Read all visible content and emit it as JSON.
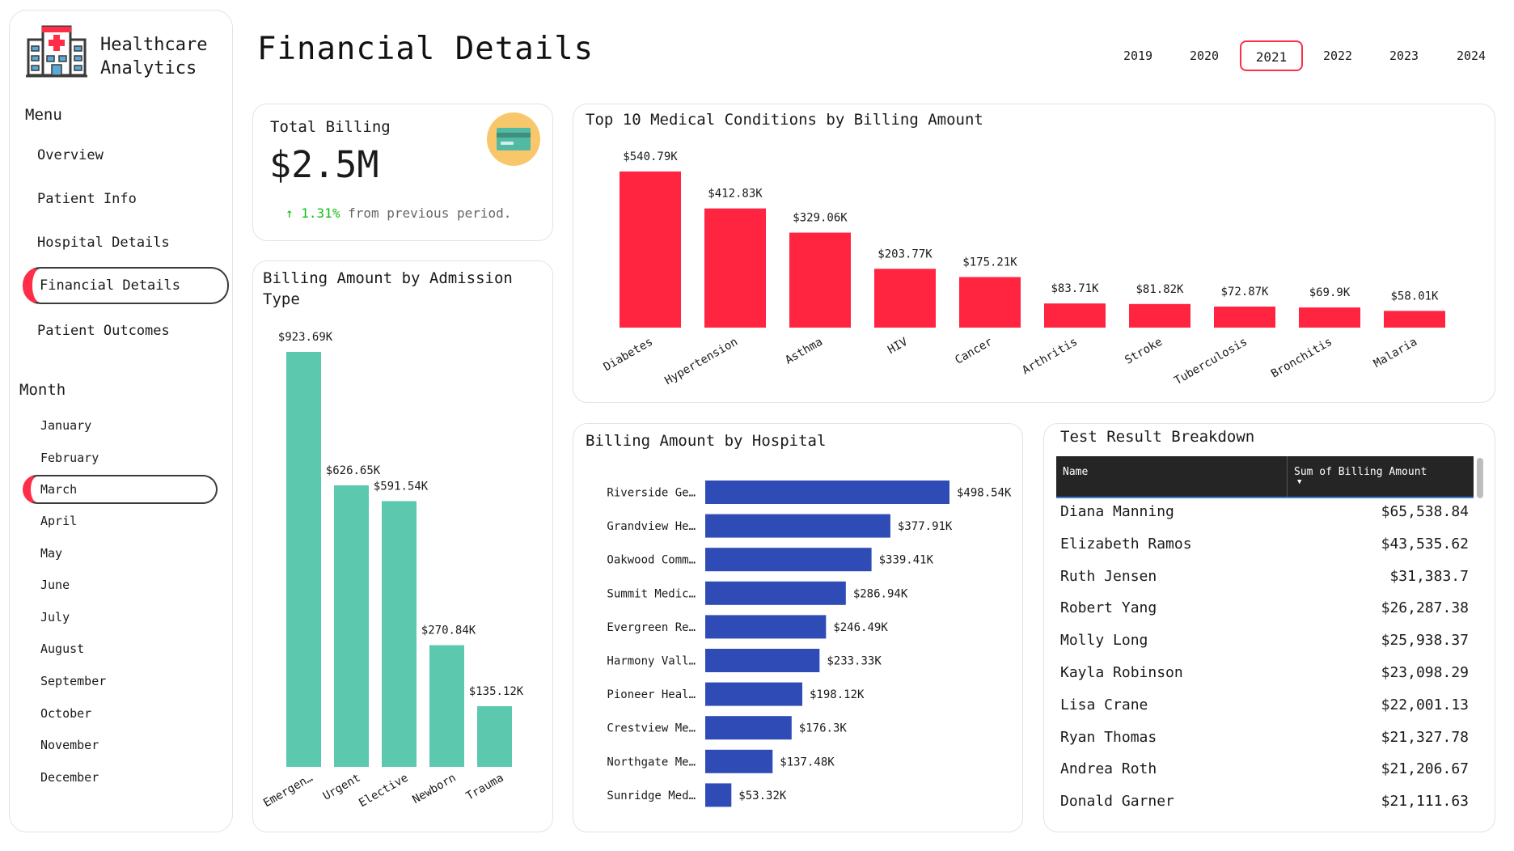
{
  "brand": {
    "line1": "Healthcare",
    "line2": "Analytics",
    "logo_icon": "hospital-building-icon"
  },
  "menu": {
    "heading": "Menu",
    "items": [
      {
        "label": "Overview",
        "active": false
      },
      {
        "label": "Patient Info",
        "active": false
      },
      {
        "label": "Hospital Details",
        "active": false
      },
      {
        "label": "Financial Details",
        "active": true
      },
      {
        "label": "Patient Outcomes",
        "active": false
      }
    ]
  },
  "month_filter": {
    "heading": "Month",
    "months": [
      "January",
      "February",
      "March",
      "April",
      "May",
      "June",
      "July",
      "August",
      "September",
      "October",
      "November",
      "December"
    ],
    "selected": "March"
  },
  "page_title": "Financial Details",
  "years": {
    "options": [
      "2019",
      "2020",
      "2021",
      "2022",
      "2023",
      "2024"
    ],
    "selected": "2021"
  },
  "total_billing": {
    "label": "Total Billing",
    "value": "$2.5M",
    "change_arrow": "↑",
    "change_pct": "1.31%",
    "change_text": "from previous period.",
    "icon": "credit-card-icon"
  },
  "colors": {
    "accent": "#ff2d47",
    "conditions_bar": "#ff2541",
    "admission_bar": "#5cc9af",
    "hospital_bar": "#2f4bb5",
    "up": "#17b917"
  },
  "chart_data": [
    {
      "type": "bar",
      "title": "Billing Amount by Admission Type",
      "categories": [
        "Emergen…",
        "Urgent",
        "Elective",
        "Newborn",
        "Trauma"
      ],
      "values": [
        923.69,
        626.65,
        591.54,
        270.84,
        135.12
      ],
      "value_labels": [
        "$923.69K",
        "$626.65K",
        "$591.54K",
        "$270.84K",
        "$135.12K"
      ],
      "units": "K"
    },
    {
      "type": "bar",
      "title": "Top 10 Medical Conditions by Billing Amount",
      "categories": [
        "Diabetes",
        "Hypertension",
        "Asthma",
        "HIV",
        "Cancer",
        "Arthritis",
        "Stroke",
        "Tuberculosis",
        "Bronchitis",
        "Malaria"
      ],
      "values": [
        540.79,
        412.83,
        329.06,
        203.77,
        175.21,
        83.71,
        81.82,
        72.87,
        69.9,
        58.01
      ],
      "value_labels": [
        "$540.79K",
        "$412.83K",
        "$329.06K",
        "$203.77K",
        "$175.21K",
        "$83.71K",
        "$81.82K",
        "$72.87K",
        "$69.9K",
        "$58.01K"
      ],
      "units": "K"
    },
    {
      "type": "bar",
      "orientation": "horizontal",
      "title": "Billing Amount by Hospital",
      "categories": [
        "Riverside Ge…",
        "Grandview He…",
        "Oakwood Comm…",
        "Summit Medic…",
        "Evergreen Re…",
        "Harmony Vall…",
        "Pioneer Heal…",
        "Crestview Me…",
        "Northgate Me…",
        "Sunridge Med…"
      ],
      "values": [
        498.54,
        377.91,
        339.41,
        286.94,
        246.49,
        233.33,
        198.12,
        176.3,
        137.48,
        53.32
      ],
      "value_labels": [
        "$498.54K",
        "$377.91K",
        "$339.41K",
        "$286.94K",
        "$246.49K",
        "$233.33K",
        "$198.12K",
        "$176.3K",
        "$137.48K",
        "$53.32K"
      ],
      "units": "K"
    },
    {
      "type": "table",
      "title": "Test Result Breakdown",
      "columns": [
        "Name",
        "Sum of Billing Amount"
      ],
      "rows": [
        [
          "Diana Manning",
          "$65,538.84"
        ],
        [
          "Elizabeth Ramos",
          "$43,535.62"
        ],
        [
          "Ruth Jensen",
          "$31,383.7"
        ],
        [
          "Robert Yang",
          "$26,287.38"
        ],
        [
          "Molly Long",
          "$25,938.37"
        ],
        [
          "Kayla Robinson",
          "$23,098.29"
        ],
        [
          "Lisa Crane",
          "$22,001.13"
        ],
        [
          "Ryan Thomas",
          "$21,327.78"
        ],
        [
          "Andrea Roth",
          "$21,206.67"
        ],
        [
          "Donald Garner",
          "$21,111.63"
        ]
      ]
    }
  ]
}
